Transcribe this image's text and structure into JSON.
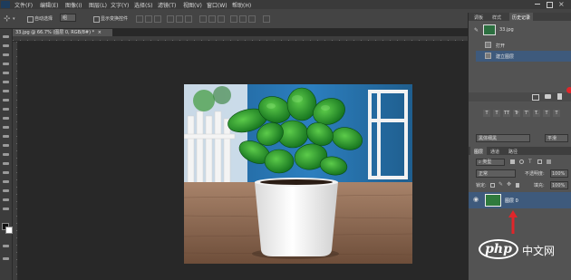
{
  "menubar": {
    "items": [
      "文件(F)",
      "编辑(E)",
      "图像(I)",
      "图层(L)",
      "文字(Y)",
      "选择(S)",
      "滤镜(T)",
      "视图(V)",
      "窗口(W)",
      "帮助(H)"
    ]
  },
  "options_bar": {
    "auto_select_label": "自动选择",
    "auto_select_value": "组",
    "show_transform_label": "显示变换控件"
  },
  "document": {
    "tab_title": "33.jpg @ 66.7% (图层 0, RGB/8#) *",
    "tab_close": "×"
  },
  "history_panel": {
    "tabs": [
      "调板",
      "样式",
      "历史记录"
    ],
    "snapshot_name": "33.jpg",
    "states": [
      "打开",
      "建立图层"
    ]
  },
  "character_panel": {
    "font_value": "黑体细黑",
    "smooth_value": "平滑",
    "style_buttons": [
      "T",
      "T",
      "TT",
      "Tr",
      "T'",
      "T.",
      "T",
      "T"
    ]
  },
  "layers_panel": {
    "tabs": [
      "图层",
      "通道",
      "路径"
    ],
    "filter_kind": "类型",
    "blend_mode": "正常",
    "opacity_label": "不透明度:",
    "opacity_value": "100%",
    "lock_label": "锁定:",
    "fill_label": "填充:",
    "fill_value": "100%",
    "layer_name": "图层 0"
  },
  "watermark": {
    "brand": "php",
    "site": "中文网"
  },
  "colors": {
    "accent_red": "#e0262a",
    "selected_row": "#3e5a7c"
  }
}
